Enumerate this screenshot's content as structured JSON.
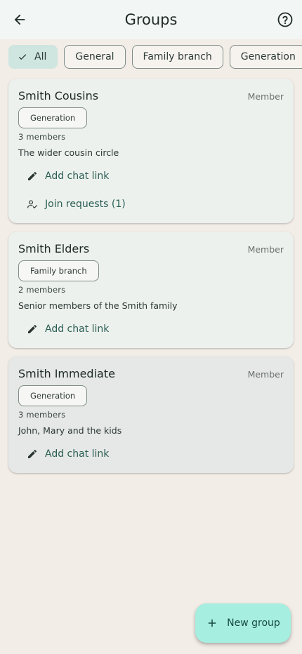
{
  "header": {
    "title": "Groups",
    "back_icon": "arrow-left-icon",
    "help_icon": "help-circle-icon"
  },
  "filters": [
    {
      "label": "All",
      "selected": true
    },
    {
      "label": "General",
      "selected": false
    },
    {
      "label": "Family branch",
      "selected": false
    },
    {
      "label": "Generation",
      "selected": false
    }
  ],
  "groups": [
    {
      "name": "Smith Cousins",
      "role": "Member",
      "tag": "Generation",
      "members": "3 members",
      "description": "The wider cousin circle",
      "actions": [
        "Add chat link",
        "Join requests (1)"
      ]
    },
    {
      "name": "Smith Elders",
      "role": "Member",
      "tag": "Family branch",
      "members": "2 members",
      "description": "Senior members of the Smith family",
      "actions": [
        "Add chat link"
      ]
    },
    {
      "name": "Smith Immediate",
      "role": "Member",
      "tag": "Generation",
      "members": "3 members",
      "description": "John, Mary and the kids",
      "actions": [
        "Add chat link"
      ]
    }
  ],
  "fab": {
    "label": "New group",
    "icon": "plus-icon"
  },
  "colors": {
    "appbar_bg": "#f2f6f4",
    "page_bg": "#f3ede7",
    "card_bg": "#ecf1ee",
    "selected_chip_bg": "#cfe6e0",
    "accent_text": "#2b5e53",
    "fab_bg": "#a6eee0"
  }
}
